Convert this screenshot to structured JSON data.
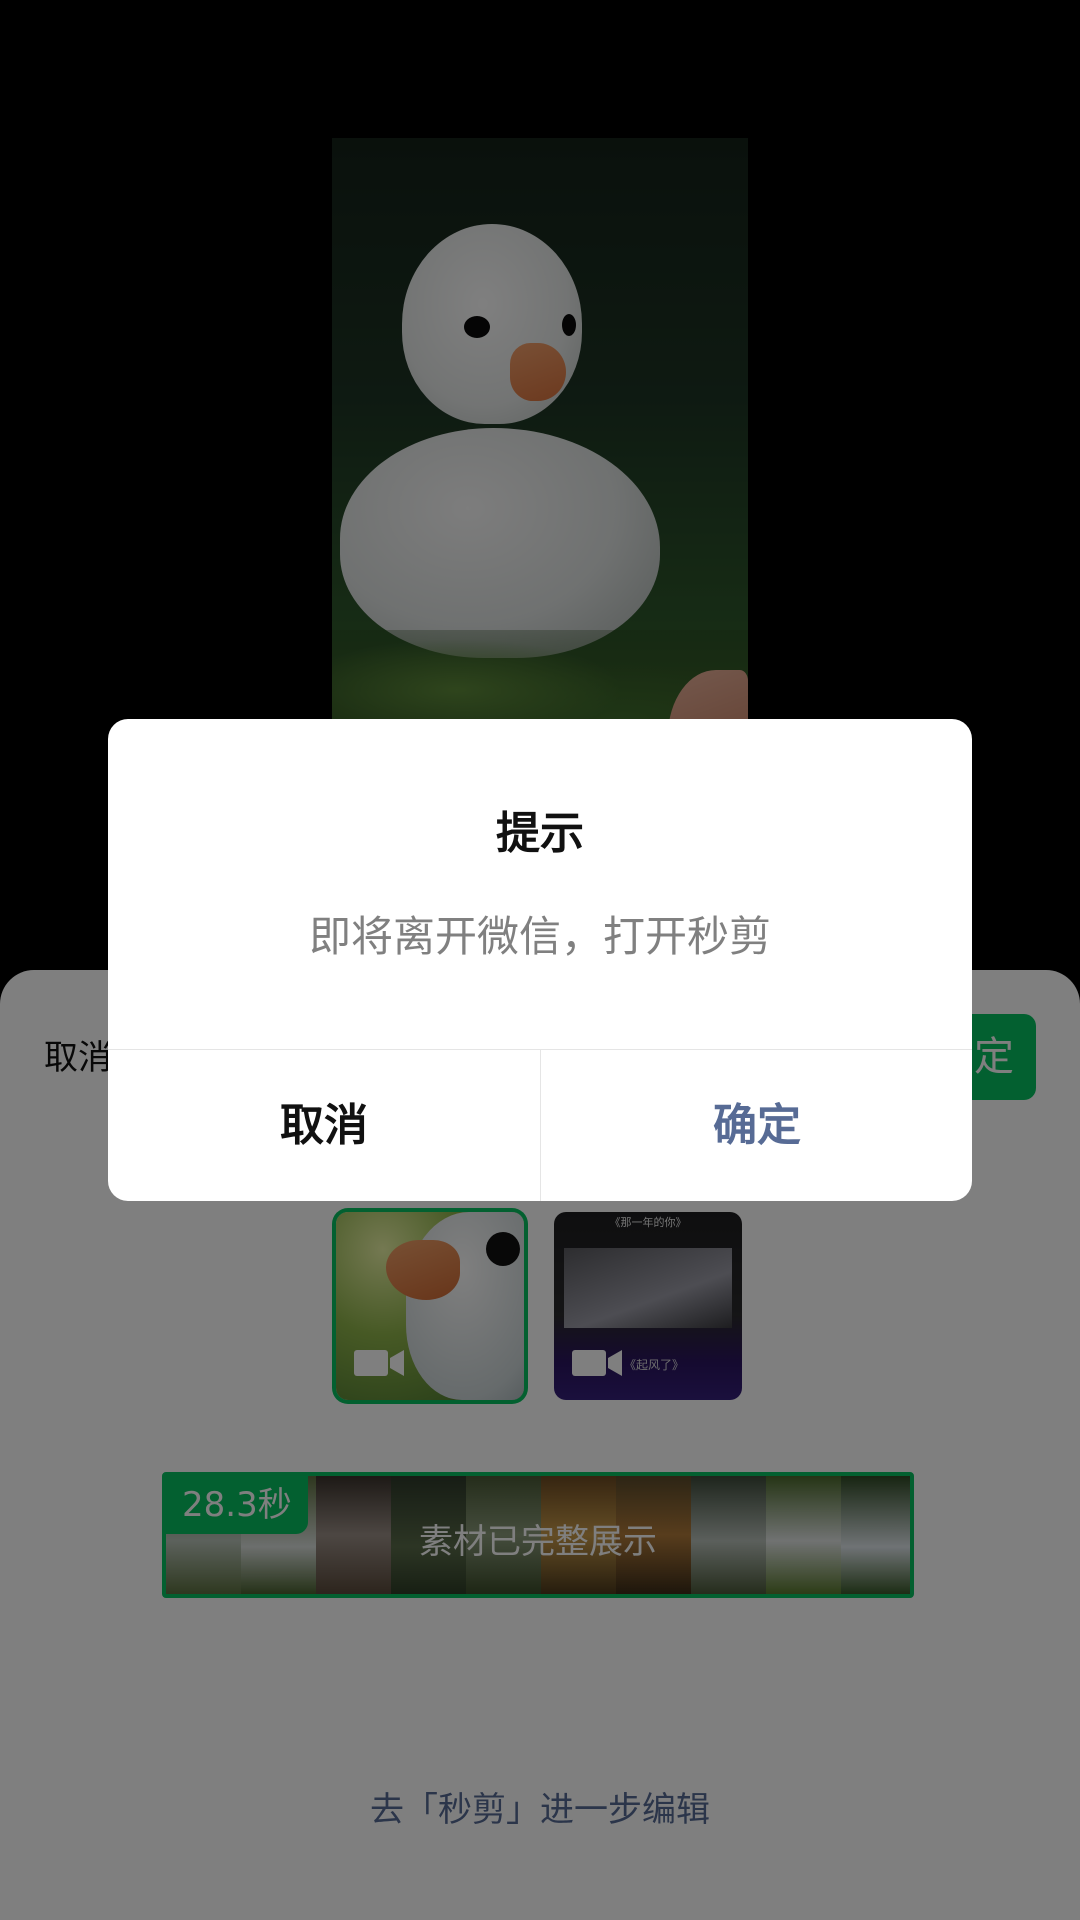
{
  "sheet": {
    "cancel_label": "取消",
    "confirm_label": "确定"
  },
  "media": {
    "items": [
      {
        "type": "video",
        "selected": true,
        "icon": "video-camera-icon"
      },
      {
        "type": "video",
        "selected": false,
        "icon": "video-camera-icon",
        "title_text": "《那一年的你》",
        "caption_text": "《起风了》"
      }
    ],
    "duration": "28.3秒",
    "timeline_text": "素材已完整展示"
  },
  "edit_link": "去「秒剪」进一步编辑",
  "dialog": {
    "title": "提示",
    "message": "即将离开微信，打开秒剪",
    "cancel_label": "取消",
    "confirm_label": "确定"
  },
  "colors": {
    "accent": "#07c160",
    "link": "#576b95"
  }
}
